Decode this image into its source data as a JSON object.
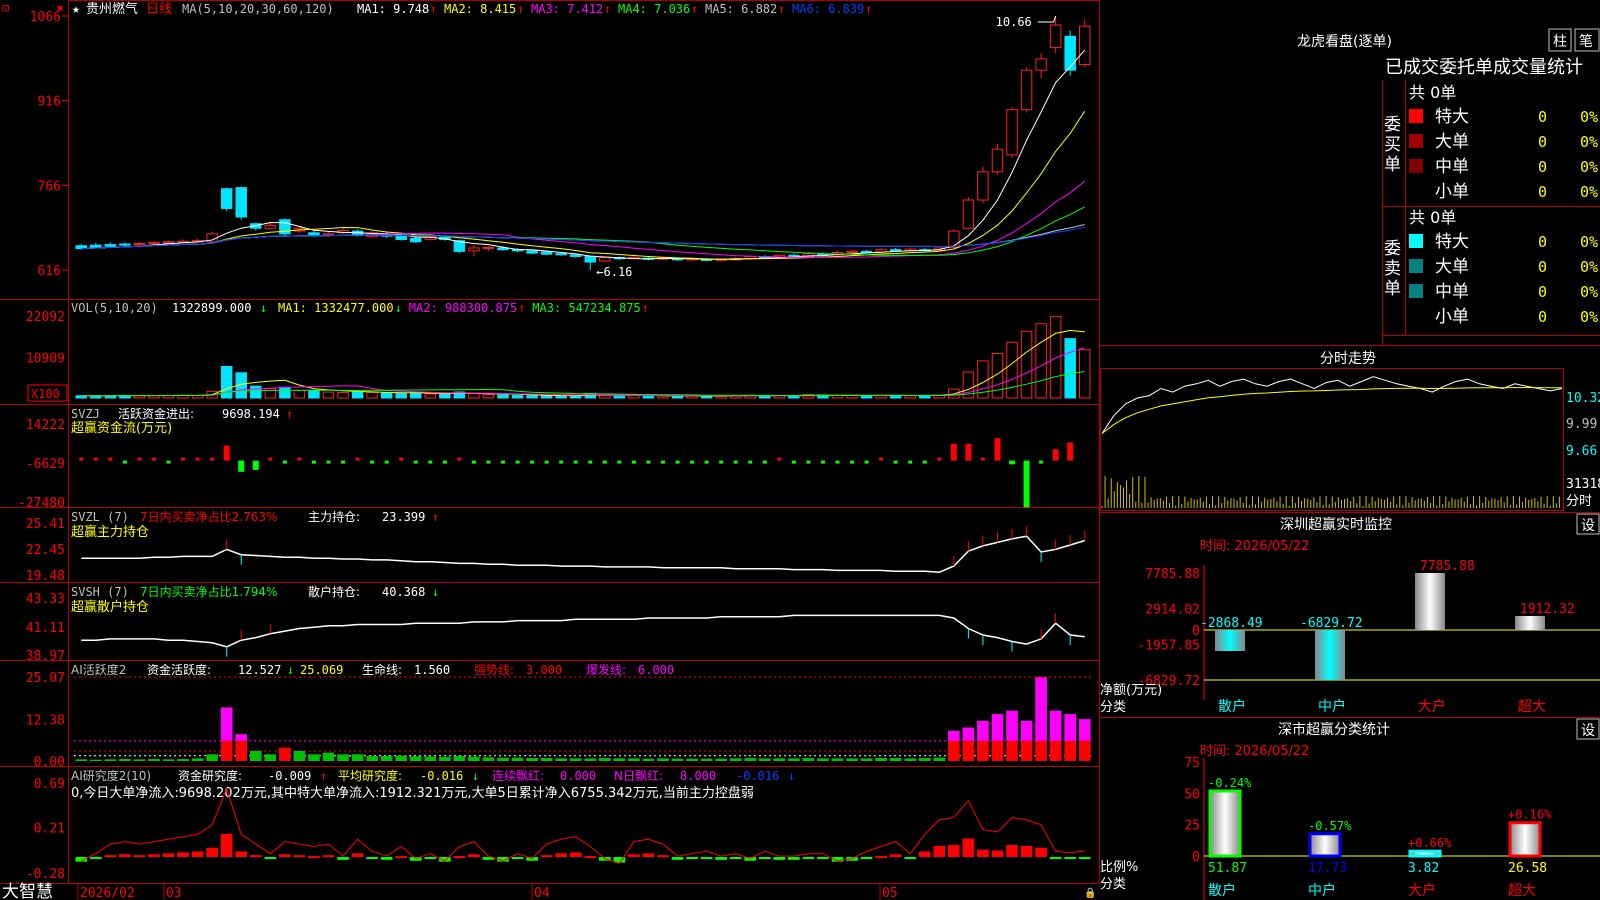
{
  "toolbar": {
    "logo_left": "⊡",
    "star": "★",
    "close": "✖"
  },
  "stock": {
    "name": "贵州燃气",
    "period": "日线"
  },
  "ma_line": {
    "prefix": "MA(5,10,20,30,60,120)",
    "items": [
      {
        "label": "MA1:",
        "value": "9.748",
        "arrow": "↑",
        "color": "#ffffff"
      },
      {
        "label": "MA2:",
        "value": "8.415",
        "arrow": "↑",
        "color": "#ffff00"
      },
      {
        "label": "MA3:",
        "value": "7.412",
        "arrow": "↑",
        "color": "#ff00ff"
      },
      {
        "label": "MA4:",
        "value": "7.036",
        "arrow": "↑",
        "color": "#00ff00"
      },
      {
        "label": "MA5:",
        "value": "6.882",
        "arrow": "↑",
        "color": "#c0c0c0"
      },
      {
        "label": "MA6:",
        "value": "6.839",
        "arrow": "↑",
        "color": "#0040ff"
      }
    ]
  },
  "price_axis": [
    "1066",
    "916",
    "766",
    "616"
  ],
  "price_annotations": {
    "high": "10.66",
    "low": "←6.16"
  },
  "vol": {
    "prefix": "VOL(5,10,20)",
    "value": "1322899.000",
    "arrow": "↓",
    "items": [
      {
        "label": "MA1:",
        "value": "1332477.000",
        "arrow": "↓",
        "color": "#ffff00"
      },
      {
        "label": "MA2:",
        "value": "988300.875",
        "arrow": "↑",
        "color": "#ff00ff"
      },
      {
        "label": "MA3:",
        "value": "547234.875",
        "arrow": "↑",
        "color": "#00ff00"
      }
    ],
    "axis": [
      "22092",
      "10909"
    ],
    "unit": "X100"
  },
  "svzj": {
    "name": "SVZJ",
    "label": "活跃资金进出:",
    "value": "9698.194",
    "arrow": "↑",
    "sub": "超赢资金流(万元)",
    "axis": [
      "14222",
      "-6629",
      "-27480"
    ]
  },
  "svzl": {
    "name": "SVZL (7)",
    "pct_label": "7日内买卖净占比2.763%",
    "hold_label": "主力持仓:",
    "hold_value": "23.399",
    "arrow": "↑",
    "sub": "超赢主力持仓",
    "axis": [
      "25.41",
      "22.45",
      "19.48"
    ]
  },
  "svsh": {
    "name": "SVSH (7)",
    "pct_label": "7日内买卖净占比1.794%",
    "hold_label": "散户持仓:",
    "hold_value": "40.368",
    "arrow": "↓",
    "sub": "超赢散户持仓",
    "axis": [
      "43.33",
      "41.11",
      "38.97"
    ]
  },
  "ai_active": {
    "name": "AI活跃度2",
    "label": "资金活跃度:",
    "value": "12.527",
    "arrow": "↓",
    "v2": "25.069",
    "life_label": "生命线:",
    "life_value": "1.560",
    "strong_label": "强势线:",
    "strong_value": "3.000",
    "burst_label": "爆发线:",
    "burst_value": "6.000",
    "axis": [
      "25.07",
      "12.38",
      "0.00"
    ]
  },
  "ai_research": {
    "name": "AI研究度2(10)",
    "label": "资金研究度:",
    "value": "-0.009",
    "arrow": "↑",
    "avg_label": "平均研究度:",
    "avg_value": "-0.016",
    "avg_arrow": "↓",
    "red_label": "连续飘红:",
    "red_value": "0.000",
    "n_label": "N日飘红:",
    "n_value": "8.000",
    "last_value": "-0.016",
    "last_arrow": "↓",
    "desc": "0,今日大单净流入:9698.202万元,其中特大单净流入:1912.321万元,大单5日累计净入6755.342万元,当前主力控盘弱",
    "axis": [
      "0.69",
      "0.21",
      "-0.28"
    ]
  },
  "bottom": {
    "brand": "大智慧",
    "dates": [
      "2026/02",
      "03",
      "04",
      "05"
    ]
  },
  "right": {
    "dragon_title": "龙虎看盘(逐单)",
    "btn_zhu": "柱",
    "btn_bi": "笔",
    "stats_title": "已成交委托单成交量统计",
    "buy_total": "共 0单",
    "sell_total": "共 0单",
    "buy_label": "委买单",
    "sell_label": "委卖单",
    "buy_rows": [
      {
        "name": "特大",
        "count": "0",
        "pct": "0%",
        "color": "#ff0000"
      },
      {
        "name": "大单",
        "count": "0",
        "pct": "0%",
        "color": "#a00000"
      },
      {
        "name": "中单",
        "count": "0",
        "pct": "0%",
        "color": "#800000"
      },
      {
        "name": "小单",
        "count": "0",
        "pct": "0%",
        "color": ""
      }
    ],
    "sell_rows": [
      {
        "name": "特大",
        "count": "0",
        "pct": "0%",
        "color": "#00ffff"
      },
      {
        "name": "大单",
        "count": "0",
        "pct": "0%",
        "color": "#008080"
      },
      {
        "name": "中单",
        "count": "0",
        "pct": "0%",
        "color": "#008080"
      },
      {
        "name": "小单",
        "count": "0",
        "pct": "0%",
        "color": ""
      }
    ],
    "intraday_title": "分时走势",
    "intraday_axis": [
      "10.32",
      "9.99",
      "9.66",
      "31318",
      "分时"
    ],
    "sz_title": "深圳超赢实时监控",
    "set_btn": "设",
    "time_label": "时间: 2026/05/22",
    "sz_axis": [
      "7785.88",
      "2914.02",
      "0",
      "-1957.85",
      "-6829.72"
    ],
    "sz_axis_title": "净额(万元)",
    "category_label": "分类",
    "sz_bars": [
      {
        "cat": "散户",
        "value": -2868.49,
        "label": "-2868.49"
      },
      {
        "cat": "中户",
        "value": -6829.72,
        "label": "-6829.72"
      },
      {
        "cat": "大户",
        "value": 7785.88,
        "label": "7785.88"
      },
      {
        "cat": "超大",
        "value": 1912.32,
        "label": "1912.32"
      }
    ],
    "stat_title": "深市超赢分类统计",
    "stat_axis": [
      "75",
      "50",
      "25",
      "0"
    ],
    "stat_axis_title": "比例%",
    "stat_bars": [
      {
        "cat": "散户",
        "value": 51.87,
        "label": "51.87",
        "chg": "-0.24%",
        "color": "#00ff00"
      },
      {
        "cat": "中户",
        "value": 17.73,
        "label": "17.73",
        "chg": "-0.57%",
        "color": "#0000ff"
      },
      {
        "cat": "大户",
        "value": 3.82,
        "label": "3.82",
        "chg": "+0.66%",
        "color": "#00ffff"
      },
      {
        "cat": "超大",
        "value": 26.58,
        "label": "26.58",
        "chg": "+0.16%",
        "color": "#ff0000"
      }
    ]
  },
  "chart_data": [
    {
      "type": "candlestick",
      "title": "贵州燃气 日线",
      "ylim": [
        6.16,
        10.66
      ],
      "x_ticks": [
        "2026/02",
        "03",
        "04",
        "05"
      ],
      "candles": [
        [
          6.59,
          6.54,
          6.62,
          6.52
        ],
        [
          6.6,
          6.56,
          6.64,
          6.55
        ],
        [
          6.61,
          6.58,
          6.65,
          6.56
        ],
        [
          6.62,
          6.6,
          6.65,
          6.58
        ],
        [
          6.62,
          6.63,
          6.66,
          6.6
        ],
        [
          6.63,
          6.65,
          6.67,
          6.61
        ],
        [
          6.64,
          6.66,
          6.68,
          6.62
        ],
        [
          6.65,
          6.67,
          6.7,
          6.63
        ],
        [
          6.66,
          6.68,
          6.71,
          6.64
        ],
        [
          6.66,
          6.8,
          6.84,
          6.65
        ],
        [
          7.6,
          7.25,
          7.62,
          7.2
        ],
        [
          7.62,
          7.1,
          7.64,
          7.05
        ],
        [
          6.98,
          6.9,
          7.0,
          6.86
        ],
        [
          6.9,
          6.95,
          7.02,
          6.88
        ],
        [
          7.05,
          6.8,
          7.08,
          6.77
        ],
        [
          6.85,
          6.9,
          6.92,
          6.82
        ],
        [
          6.82,
          6.77,
          6.86,
          6.74
        ],
        [
          6.78,
          6.8,
          6.83,
          6.75
        ],
        [
          6.82,
          6.86,
          6.9,
          6.8
        ],
        [
          6.85,
          6.78,
          6.88,
          6.75
        ],
        [
          6.75,
          6.82,
          6.85,
          6.73
        ],
        [
          6.8,
          6.76,
          6.83,
          6.73
        ],
        [
          6.78,
          6.7,
          6.8,
          6.68
        ],
        [
          6.72,
          6.66,
          6.75,
          6.64
        ],
        [
          6.7,
          6.75,
          6.8,
          6.68
        ],
        [
          6.74,
          6.7,
          6.77,
          6.68
        ],
        [
          6.68,
          6.49,
          6.7,
          6.46
        ],
        [
          6.5,
          6.55,
          6.6,
          6.4
        ],
        [
          6.55,
          6.56,
          6.58,
          6.5
        ],
        [
          6.55,
          6.52,
          6.58,
          6.5
        ],
        [
          6.52,
          6.5,
          6.55,
          6.48
        ],
        [
          6.5,
          6.46,
          6.52,
          6.44
        ],
        [
          6.48,
          6.44,
          6.5,
          6.42
        ],
        [
          6.45,
          6.43,
          6.47,
          6.41
        ],
        [
          6.43,
          6.4,
          6.45,
          6.38
        ],
        [
          6.4,
          6.3,
          6.42,
          6.16
        ],
        [
          6.32,
          6.38,
          6.4,
          6.3
        ],
        [
          6.38,
          6.36,
          6.4,
          6.34
        ],
        [
          6.36,
          6.38,
          6.41,
          6.34
        ],
        [
          6.37,
          6.35,
          6.39,
          6.33
        ],
        [
          6.35,
          6.37,
          6.39,
          6.33
        ],
        [
          6.36,
          6.34,
          6.38,
          6.32
        ],
        [
          6.34,
          6.36,
          6.38,
          6.32
        ],
        [
          6.35,
          6.33,
          6.37,
          6.31
        ],
        [
          6.33,
          6.35,
          6.37,
          6.31
        ],
        [
          6.34,
          6.36,
          6.39,
          6.32
        ],
        [
          6.36,
          6.4,
          6.42,
          6.34
        ],
        [
          6.4,
          6.38,
          6.42,
          6.36
        ],
        [
          6.38,
          6.42,
          6.44,
          6.36
        ],
        [
          6.42,
          6.4,
          6.45,
          6.38
        ],
        [
          6.4,
          6.45,
          6.48,
          6.38
        ],
        [
          6.44,
          6.43,
          6.47,
          6.41
        ],
        [
          6.43,
          6.47,
          6.5,
          6.41
        ],
        [
          6.47,
          6.49,
          6.52,
          6.45
        ],
        [
          6.49,
          6.47,
          6.52,
          6.45
        ],
        [
          6.48,
          6.52,
          6.55,
          6.46
        ],
        [
          6.52,
          6.5,
          6.55,
          6.48
        ],
        [
          6.5,
          6.53,
          6.56,
          6.48
        ],
        [
          6.52,
          6.51,
          6.55,
          6.49
        ],
        [
          6.51,
          6.55,
          6.58,
          6.5
        ],
        [
          6.56,
          6.85,
          6.88,
          6.55
        ],
        [
          6.9,
          7.4,
          7.45,
          6.88
        ],
        [
          7.4,
          7.9,
          8.0,
          7.35
        ],
        [
          7.9,
          8.3,
          8.4,
          7.85
        ],
        [
          8.2,
          9.0,
          9.05,
          8.15
        ],
        [
          9.0,
          9.7,
          9.75,
          8.95
        ],
        [
          9.7,
          9.9,
          10.0,
          9.55
        ],
        [
          10.1,
          10.5,
          10.66,
          10.0
        ],
        [
          10.3,
          9.7,
          10.4,
          9.6
        ],
        [
          9.8,
          10.48,
          10.6,
          9.75
        ]
      ]
    },
    {
      "type": "bar",
      "title": "VOL(5,10,20)",
      "unit": "X100",
      "ylim": [
        0,
        22092
      ],
      "values": [
        600,
        650,
        620,
        700,
        640,
        680,
        700,
        720,
        650,
        1800,
        8500,
        6800,
        3200,
        2500,
        2900,
        2000,
        1900,
        1600,
        1500,
        1700,
        1500,
        1300,
        1200,
        1500,
        1100,
        1000,
        1600,
        1200,
        900,
        800,
        700,
        650,
        600,
        550,
        600,
        1200,
        700,
        600,
        650,
        600,
        550,
        500,
        560,
        520,
        500,
        600,
        800,
        700,
        650,
        600,
        900,
        800,
        700,
        750,
        650,
        700,
        800,
        650,
        700,
        800,
        2400,
        7000,
        10000,
        12000,
        15000,
        18000,
        20000,
        22000,
        16000,
        13000
      ]
    },
    {
      "type": "bar",
      "title": "超赢资金流(万元)",
      "ylim": [
        -27480,
        14222
      ],
      "values": [
        200,
        150,
        100,
        -100,
        180,
        120,
        -200,
        250,
        150,
        300,
        8000,
        -6000,
        -5000,
        1000,
        -800,
        600,
        -500,
        -400,
        -600,
        900,
        -300,
        -400,
        500,
        -300,
        -200,
        -600,
        400,
        -300,
        -500,
        -200,
        -300,
        -400,
        -200,
        -300,
        -200,
        -500,
        -300,
        -200,
        -300,
        -100,
        -200,
        -300,
        -100,
        -200,
        -300,
        -100,
        -200,
        -300,
        200,
        -100,
        -200,
        -300,
        -100,
        -200,
        -300,
        200,
        -100,
        -300,
        -200,
        800,
        9000,
        9000,
        500,
        12000,
        -2000,
        -25000,
        -500,
        6000,
        9698
      ]
    },
    {
      "type": "line",
      "title": "超赢主力持仓",
      "ylim": [
        19.48,
        25.41
      ],
      "values": [
        21.4,
        21.4,
        21.4,
        21.4,
        21.4,
        21.5,
        21.5,
        21.6,
        21.6,
        21.6,
        22.4,
        21.8,
        21.7,
        21.6,
        21.5,
        21.5,
        21.4,
        21.4,
        21.3,
        21.3,
        21.2,
        21.2,
        21.1,
        21.0,
        21.0,
        20.9,
        20.8,
        20.8,
        20.7,
        20.7,
        20.6,
        20.6,
        20.6,
        20.5,
        20.5,
        20.5,
        20.4,
        20.4,
        20.4,
        20.4,
        20.3,
        20.3,
        20.3,
        20.3,
        20.3,
        20.2,
        20.2,
        20.2,
        20.2,
        20.1,
        20.1,
        20.1,
        20.0,
        20.0,
        20.0,
        20.0,
        19.9,
        19.9,
        19.9,
        19.8,
        20.5,
        22.2,
        22.8,
        23.2,
        23.6,
        23.9,
        22.1,
        22.4,
        22.9,
        23.4
      ]
    },
    {
      "type": "line",
      "title": "超赢散户持仓",
      "ylim": [
        38.97,
        43.33
      ],
      "values": [
        40.1,
        40.1,
        40.2,
        40.2,
        40.2,
        40.2,
        40.1,
        40.1,
        40.0,
        39.9,
        39.6,
        40.1,
        40.3,
        40.6,
        40.8,
        41.0,
        41.1,
        41.2,
        41.2,
        41.3,
        41.3,
        41.3,
        41.3,
        41.4,
        41.4,
        41.4,
        41.4,
        41.5,
        41.5,
        41.5,
        41.6,
        41.6,
        41.6,
        41.6,
        41.7,
        41.7,
        41.7,
        41.7,
        41.7,
        41.8,
        41.8,
        41.8,
        41.8,
        41.8,
        41.9,
        41.9,
        41.9,
        41.9,
        41.9,
        42.0,
        42.0,
        42.0,
        42.0,
        42.0,
        42.0,
        42.0,
        42.0,
        42.0,
        42.0,
        42.0,
        41.8,
        41.0,
        40.5,
        40.3,
        40.0,
        39.8,
        40.2,
        41.4,
        40.5,
        40.37
      ]
    },
    {
      "type": "bar",
      "title": "AI活跃度2",
      "ylim": [
        0,
        25.07
      ],
      "values": [
        0.5,
        0.4,
        0.5,
        0.6,
        0.5,
        0.6,
        0.5,
        0.6,
        0.8,
        2,
        16,
        8,
        3,
        2,
        4,
        3,
        2,
        2.5,
        2,
        2,
        1.5,
        1.5,
        1.6,
        1.4,
        1.3,
        1.2,
        1.5,
        1.3,
        1.1,
        1,
        1,
        0.9,
        0.9,
        0.8,
        0.8,
        0.8,
        0.9,
        0.8,
        0.8,
        0.7,
        0.8,
        0.7,
        0.7,
        0.7,
        0.7,
        0.8,
        0.9,
        0.8,
        0.8,
        0.8,
        0.9,
        0.8,
        0.8,
        0.8,
        0.8,
        0.9,
        0.9,
        0.8,
        0.9,
        1,
        9,
        10,
        12,
        14,
        15,
        12,
        25,
        15,
        14,
        12.5
      ]
    },
    {
      "type": "bar",
      "title": "AI研究度2(10)",
      "ylim": [
        -0.28,
        0.69
      ],
      "values": [
        -0.05,
        -0.02,
        0.02,
        0.03,
        0.02,
        0.03,
        0.04,
        0.05,
        0.06,
        0.1,
        0.25,
        0.06,
        0.02,
        -0.02,
        0.03,
        0.02,
        0.01,
        0.02,
        -0.03,
        0.04,
        -0.01,
        -0.03,
        0.01,
        -0.04,
        -0.02,
        -0.05,
        0.01,
        0.03,
        -0.03,
        -0.05,
        -0.02,
        -0.04,
        0.02,
        0.04,
        0.05,
        0.01,
        -0.04,
        -0.06,
        0.03,
        0.04,
        0.02,
        -0.03,
        -0.02,
        -0.01,
        -0.03,
        -0.02,
        -0.04,
        -0.01,
        -0.03,
        -0.03,
        -0.02,
        -0.02,
        -0.05,
        -0.04,
        -0.01,
        0.01,
        0.03,
        -0.02,
        0.06,
        0.12,
        0.13,
        0.2,
        0.08,
        0.07,
        0.13,
        0.12,
        0.1,
        -0.01,
        -0.016,
        -0.009
      ]
    },
    {
      "type": "line",
      "title": "分时走势",
      "ylim": [
        9.66,
        10.32
      ],
      "values": [
        9.8,
        9.95,
        10.05,
        10.1,
        10.12,
        10.18,
        10.15,
        10.2,
        10.22,
        10.25,
        10.2,
        10.24,
        10.26,
        10.22,
        10.2,
        10.24,
        10.26,
        10.22,
        10.18,
        10.23,
        10.25,
        10.2,
        10.24,
        10.28,
        10.25,
        10.22,
        10.2,
        10.18,
        10.15,
        10.2,
        10.24,
        10.26,
        10.22,
        10.2,
        10.18,
        10.22,
        10.2,
        10.18,
        10.16,
        10.18
      ]
    },
    {
      "type": "bar",
      "title": "深圳超赢实时监控",
      "ylabel": "净额(万元)",
      "ylim": [
        -6829.72,
        7785.88
      ],
      "categories": [
        "散户",
        "中户",
        "大户",
        "超大"
      ],
      "values": [
        -2868.49,
        -6829.72,
        7785.88,
        1912.32
      ]
    },
    {
      "type": "bar",
      "title": "深市超赢分类统计",
      "ylabel": "比例%",
      "ylim": [
        0,
        75
      ],
      "categories": [
        "散户",
        "中户",
        "大户",
        "超大"
      ],
      "values": [
        51.87,
        17.73,
        3.82,
        26.58
      ]
    }
  ]
}
